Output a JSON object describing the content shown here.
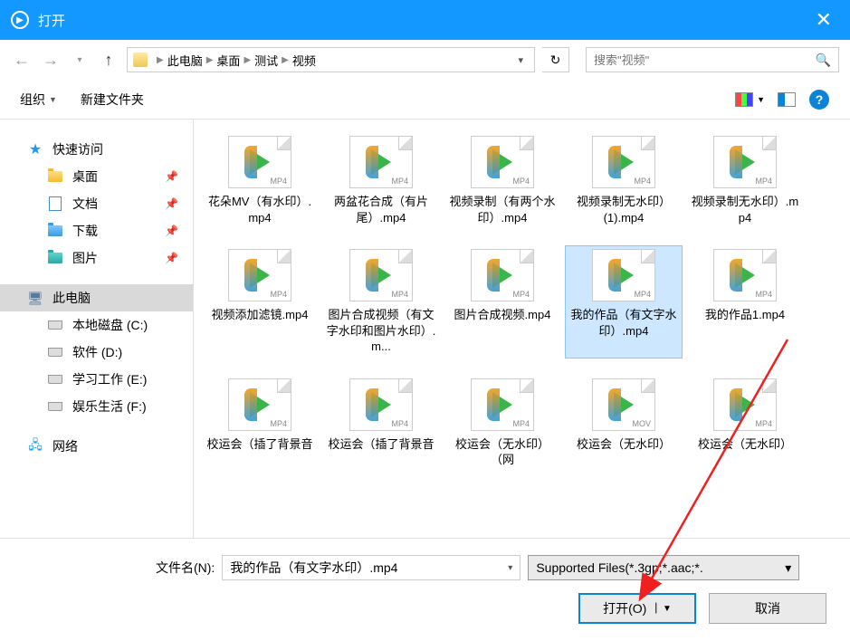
{
  "title": "打开",
  "breadcrumb": {
    "parts": [
      "此电脑",
      "桌面",
      "测试",
      "视频"
    ]
  },
  "search": {
    "placeholder": "搜索\"视频\""
  },
  "toolbar": {
    "organize": "组织",
    "new_folder": "新建文件夹"
  },
  "sidebar": {
    "quick_access": "快速访问",
    "desktop": "桌面",
    "documents": "文档",
    "downloads": "下载",
    "pictures": "图片",
    "this_pc": "此电脑",
    "drive_c": "本地磁盘 (C:)",
    "drive_d": "软件 (D:)",
    "drive_e": "学习工作 (E:)",
    "drive_f": "娱乐生活 (F:)",
    "network": "网络"
  },
  "files": [
    {
      "name": "花朵MV（有水印）.mp4",
      "ext": "MP4",
      "selected": false
    },
    {
      "name": "两盆花合成（有片尾）.mp4",
      "ext": "MP4",
      "selected": false
    },
    {
      "name": "视频录制（有两个水印）.mp4",
      "ext": "MP4",
      "selected": false
    },
    {
      "name": "视频录制无水印）(1).mp4",
      "ext": "MP4",
      "selected": false
    },
    {
      "name": "视频录制无水印）.mp4",
      "ext": "MP4",
      "selected": false
    },
    {
      "name": "视频添加滤镜.mp4",
      "ext": "MP4",
      "selected": false
    },
    {
      "name": "图片合成视频（有文字水印和图片水印）.m...",
      "ext": "MP4",
      "selected": false
    },
    {
      "name": "图片合成视频.mp4",
      "ext": "MP4",
      "selected": false
    },
    {
      "name": "我的作品（有文字水印）.mp4",
      "ext": "MP4",
      "selected": true
    },
    {
      "name": "我的作品1.mp4",
      "ext": "MP4",
      "selected": false
    },
    {
      "name": "校运会（插了背景音",
      "ext": "MP4",
      "selected": false
    },
    {
      "name": "校运会（插了背景音",
      "ext": "MP4",
      "selected": false
    },
    {
      "name": "校运会（无水印）（网",
      "ext": "MP4",
      "selected": false
    },
    {
      "name": "校运会（无水印）",
      "ext": "MOV",
      "selected": false
    },
    {
      "name": "校运会（无水印）",
      "ext": "MP4",
      "selected": false
    }
  ],
  "bottom": {
    "filename_label": "文件名(N):",
    "filename_value": "我的作品（有文字水印）.mp4",
    "type_filter": "Supported Files(*.3gp;*.aac;*.",
    "open_btn": "打开(O)",
    "cancel_btn": "取消"
  }
}
